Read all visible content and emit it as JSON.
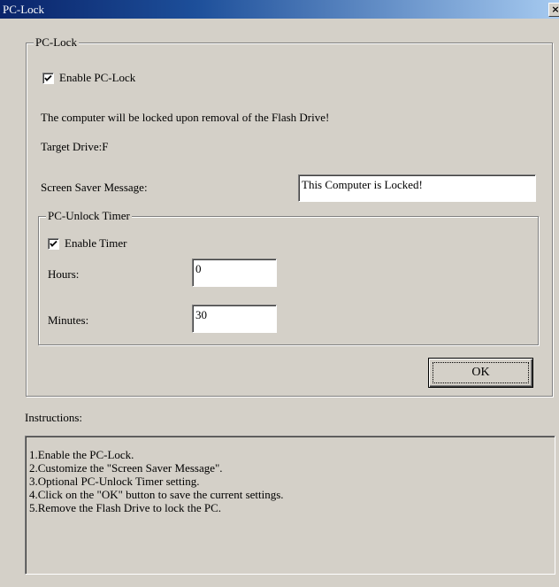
{
  "window": {
    "title": "PC-Lock",
    "close_glyph": "×"
  },
  "pclock_group": {
    "legend": "PC-Lock",
    "enable_label": "Enable PC-Lock",
    "enable_checked": true,
    "notice": "The computer will be locked upon removal of the Flash Drive!",
    "target_drive": "Target Drive:F",
    "message_label": "Screen Saver Message:",
    "message_value": "This Computer is Locked!"
  },
  "timer_group": {
    "legend": "PC-Unlock Timer",
    "enable_label": "Enable Timer",
    "enable_checked": true,
    "hours_label": "Hours:",
    "hours_value": "0",
    "minutes_label": "Minutes:",
    "minutes_value": "30"
  },
  "ok_label": "OK",
  "instructions": {
    "heading": "Instructions:",
    "lines": [
      "1.Enable the PC-Lock.",
      "2.Customize the \"Screen Saver Message\".",
      "3.Optional PC-Unlock Timer setting.",
      "4.Click on the \"OK\" button to save the current settings.",
      "5.Remove the Flash Drive to lock the PC."
    ]
  },
  "colors": {
    "dialog_face": "#d4d0c8",
    "titlebar_start": "#0a246a",
    "titlebar_end": "#a6caf0"
  }
}
